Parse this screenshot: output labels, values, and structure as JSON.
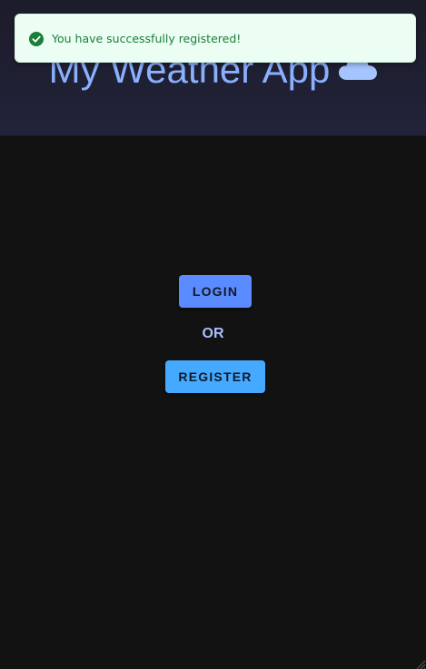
{
  "header": {
    "title": "My Weather App",
    "title_icon": "cloud-icon"
  },
  "toast": {
    "message": "You have successfully registered!",
    "icon": "check-circle-icon",
    "status_color": "#1a7f37"
  },
  "auth": {
    "login_label": "LOGIN",
    "or_label": "OR",
    "register_label": "REGISTER"
  },
  "colors": {
    "background": "#121212",
    "header_background": "#20202f",
    "title_color": "#8ab0ff",
    "login_button": "#5b8cff",
    "register_button": "#45aaff",
    "toast_background": "#ecfdf3"
  }
}
